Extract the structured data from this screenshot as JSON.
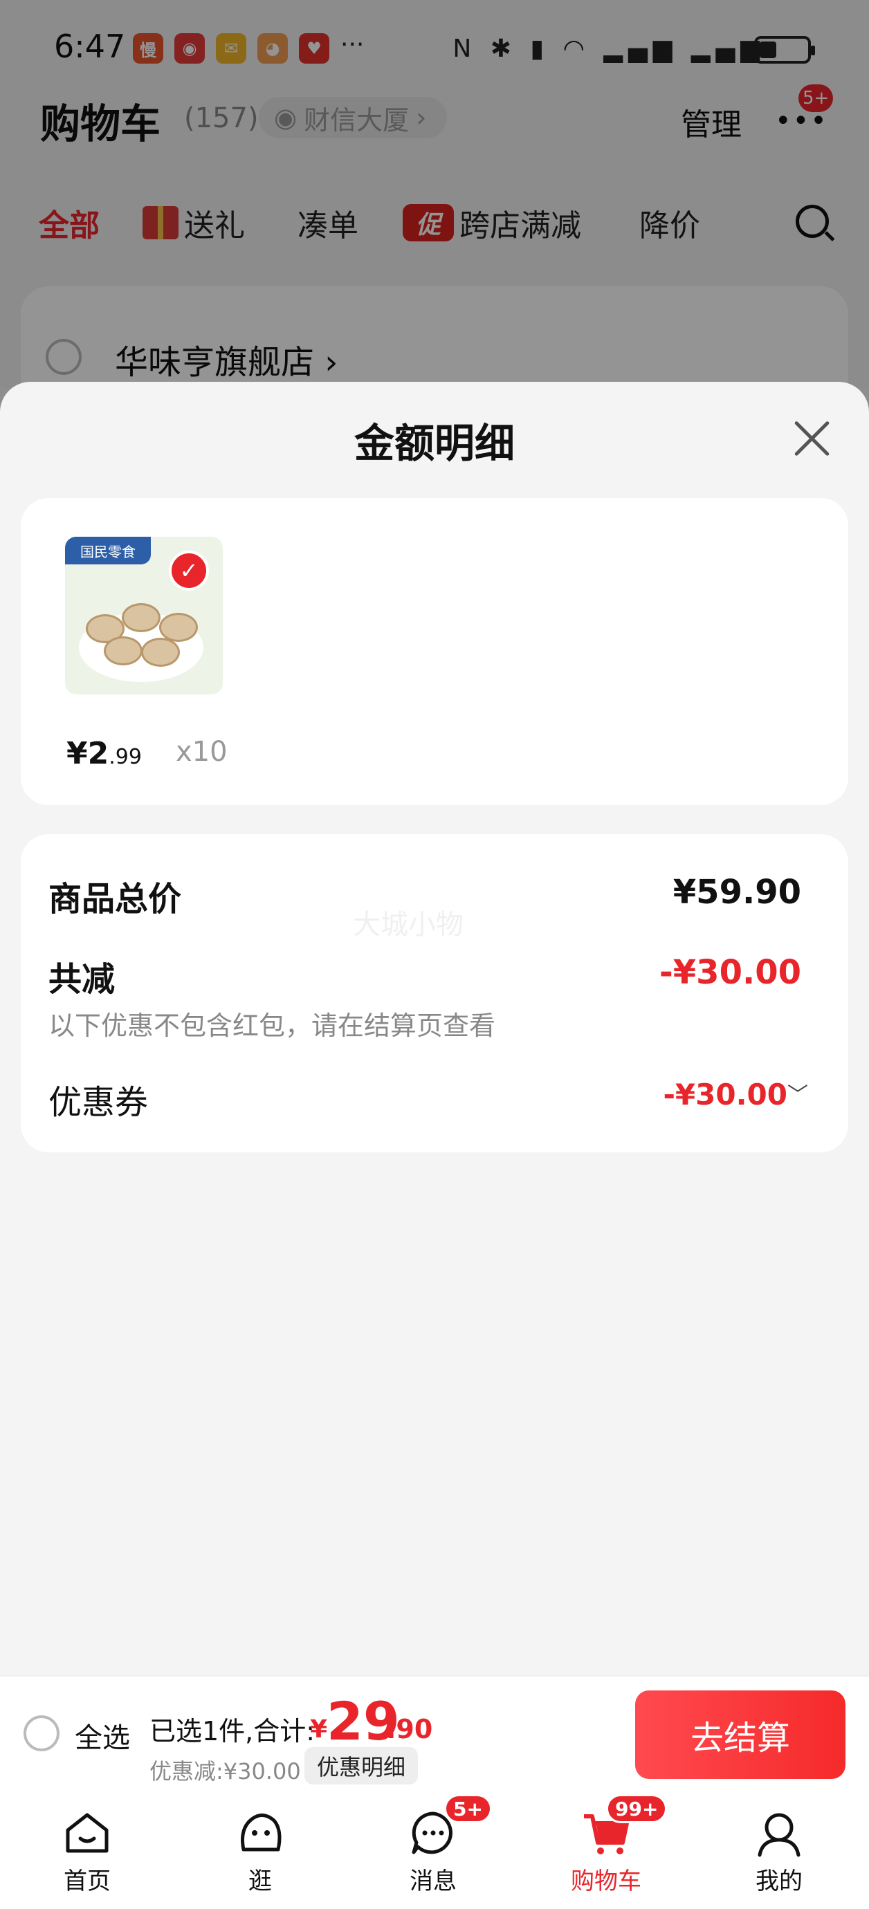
{
  "status_bar": {
    "time": "6:47",
    "more": "···"
  },
  "header": {
    "title": "购物车",
    "count": "(157)",
    "location": "财信大厦",
    "manage": "管理",
    "more_badge": "5+"
  },
  "filters": [
    "全部",
    "送礼",
    "凑单",
    "跨店满减",
    "降价"
  ],
  "promo_badge": "促",
  "store": {
    "name": "华味亨旗舰店"
  },
  "sheet": {
    "title": "金额明细",
    "item": {
      "brand_label": "国民零食",
      "price_int": "¥2",
      "price_dec": ".99",
      "quantity": "x10"
    },
    "total_label": "商品总价",
    "total_value": "¥59.90",
    "reduction_label": "共减",
    "reduction_value": "-¥30.00",
    "reduction_note": "以下优惠不包含红包，请在结算页查看",
    "coupon_label": "优惠券",
    "coupon_value": "-¥30.00",
    "watermark": "大城小物"
  },
  "checkout": {
    "select_all": "全选",
    "selected_info": "已选1件,合计:",
    "total_currency": "¥",
    "total_int": "29",
    "total_dec": ".90",
    "discount": "优惠减:¥30.00",
    "detail_button": "优惠明细",
    "pay_button": "去结算"
  },
  "tabs": [
    {
      "label": "首页",
      "icon": "home-icon"
    },
    {
      "label": "逛",
      "icon": "browse-icon"
    },
    {
      "label": "消息",
      "icon": "message-icon",
      "badge": "5+"
    },
    {
      "label": "购物车",
      "icon": "cart-icon",
      "badge": "99+"
    },
    {
      "label": "我的",
      "icon": "profile-icon"
    }
  ],
  "colors": {
    "accent": "#e8252b"
  }
}
